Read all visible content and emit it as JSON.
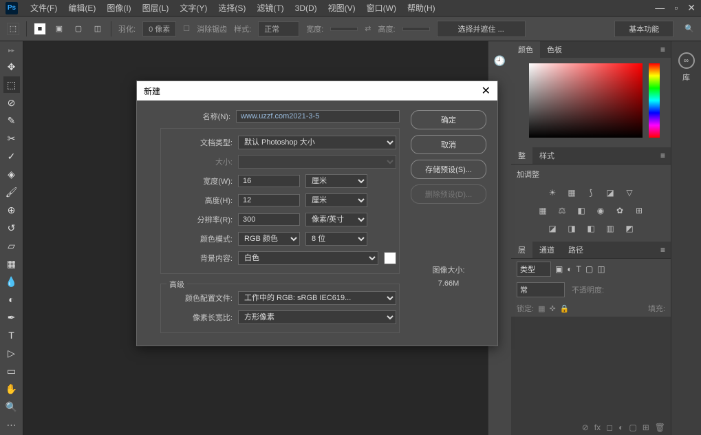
{
  "app": {
    "logo": "Ps"
  },
  "menu": [
    "文件(F)",
    "编辑(E)",
    "图像(I)",
    "图层(L)",
    "文字(Y)",
    "选择(S)",
    "滤镜(T)",
    "3D(D)",
    "视图(V)",
    "窗口(W)",
    "帮助(H)"
  ],
  "optionbar": {
    "feather_label": "羽化:",
    "feather_value": "0 像素",
    "antialias": "消除锯齿",
    "style_label": "样式:",
    "style_value": "正常",
    "width_label": "宽度:",
    "height_label": "高度:",
    "masking": "选择并遮住 ...",
    "workspace": "基本功能"
  },
  "dialog": {
    "title": "新建",
    "name_label": "名称(N):",
    "name_value": "www.uzzf.com2021-3-5",
    "doctype_label": "文档类型:",
    "doctype_value": "默认 Photoshop 大小",
    "size_label": "大小:",
    "width_label": "宽度(W):",
    "width_value": "16",
    "width_unit": "厘米",
    "height_label": "高度(H):",
    "height_value": "12",
    "height_unit": "厘米",
    "res_label": "分辨率(R):",
    "res_value": "300",
    "res_unit": "像素/英寸",
    "colormode_label": "颜色模式:",
    "colormode_value": "RGB 颜色",
    "colordepth_value": "8 位",
    "bgcontent_label": "背景内容:",
    "bgcontent_value": "白色",
    "advanced_label": "高级",
    "profile_label": "颜色配置文件:",
    "profile_value": "工作中的 RGB: sRGB IEC619...",
    "aspect_label": "像素长宽比:",
    "aspect_value": "方形像素",
    "ok": "确定",
    "cancel": "取消",
    "save_preset": "存储预设(S)...",
    "delete_preset": "删除预设(D)...",
    "imgsize_label": "图像大小:",
    "imgsize_value": "7.66M"
  },
  "panels": {
    "color_tab": "颜色",
    "swatch_tab": "色板",
    "lib_label": "库",
    "adjust_partial": "整",
    "styles_tab": "样式",
    "add_adjust": "加调整",
    "layers_partial": "层",
    "channels_tab": "通道",
    "paths_tab": "路径",
    "kind_label": "类型",
    "blend_label": "常",
    "opacity_label": "不透明度:",
    "lock_label": "锁定:",
    "fill_label": "填充:"
  }
}
